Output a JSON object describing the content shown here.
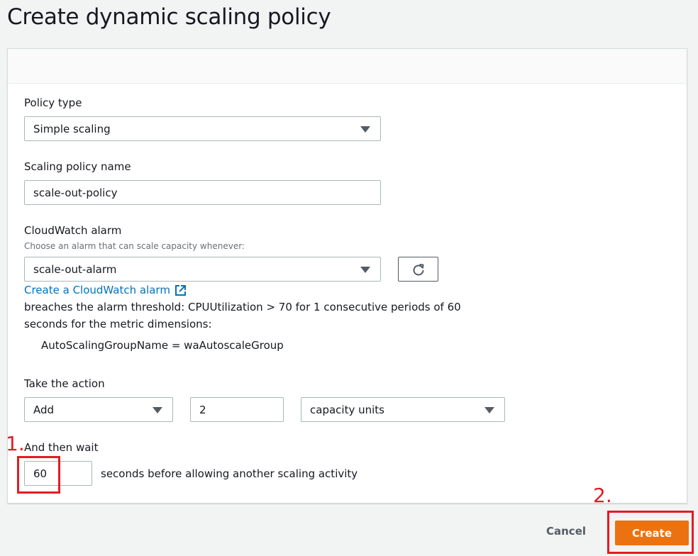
{
  "page": {
    "title": "Create dynamic scaling policy"
  },
  "form": {
    "policy_type": {
      "label": "Policy type",
      "value": "Simple scaling"
    },
    "policy_name": {
      "label": "Scaling policy name",
      "value": "scale-out-policy"
    },
    "alarm": {
      "label": "CloudWatch alarm",
      "description": "Choose an alarm that can scale capacity whenever:",
      "value": "scale-out-alarm",
      "create_link": "Create a CloudWatch alarm",
      "breach_line1": "breaches the alarm threshold: CPUUtilization > 70 for 1 consecutive periods of 60",
      "breach_line2": "seconds for the metric dimensions:",
      "dimension": "AutoScalingGroupName = waAutoscaleGroup"
    },
    "action": {
      "label": "Take the action",
      "operation": "Add",
      "amount": "2",
      "unit": "capacity units"
    },
    "wait": {
      "label": "And then wait",
      "value": "60",
      "suffix": "seconds before allowing another scaling activity"
    }
  },
  "footer": {
    "cancel_label": "Cancel",
    "create_label": "Create"
  },
  "annotations": {
    "step1": "1.",
    "step2": "2."
  },
  "colors": {
    "accent": "#ec7211",
    "link": "#0073bb",
    "annotation": "#e31c24"
  },
  "icons": {
    "refresh": "refresh-icon",
    "external": "external-link-icon",
    "dropdown": "caret-down-icon"
  }
}
